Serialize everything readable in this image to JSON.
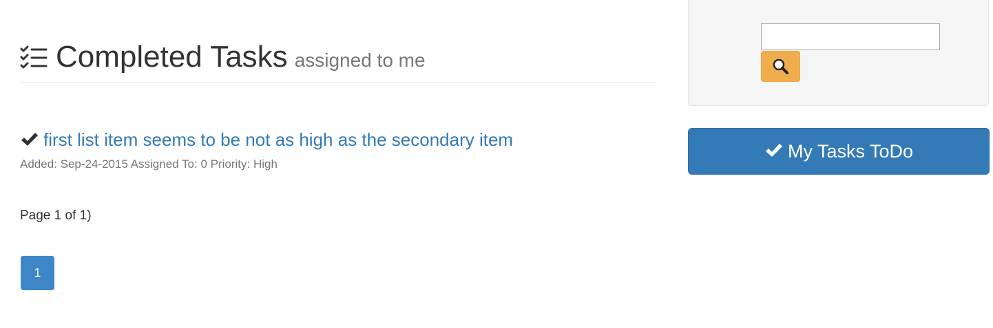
{
  "header": {
    "icon": "tasks-list-icon",
    "title": "Completed Tasks",
    "subtitle": "assigned to me"
  },
  "tasks": [
    {
      "icon": "checkmark-icon",
      "title": "first list item seems to be not as high as the secondary item",
      "meta": "Added: Sep-24-2015 Assigned To: 0 Priority: High"
    }
  ],
  "pagination": {
    "info": "Page 1 of 1)",
    "pages": [
      "1"
    ]
  },
  "search": {
    "value": "",
    "placeholder": "",
    "button_icon": "magnifier-icon"
  },
  "sidebar": {
    "todo_button_label": "My Tasks ToDo",
    "todo_button_icon": "checkmark-icon"
  },
  "colors": {
    "link": "#337ab7",
    "primary_button": "#337ab7",
    "warning_button": "#f0ad4e",
    "pagination_active": "#3d86c8",
    "muted_text": "#777777"
  }
}
